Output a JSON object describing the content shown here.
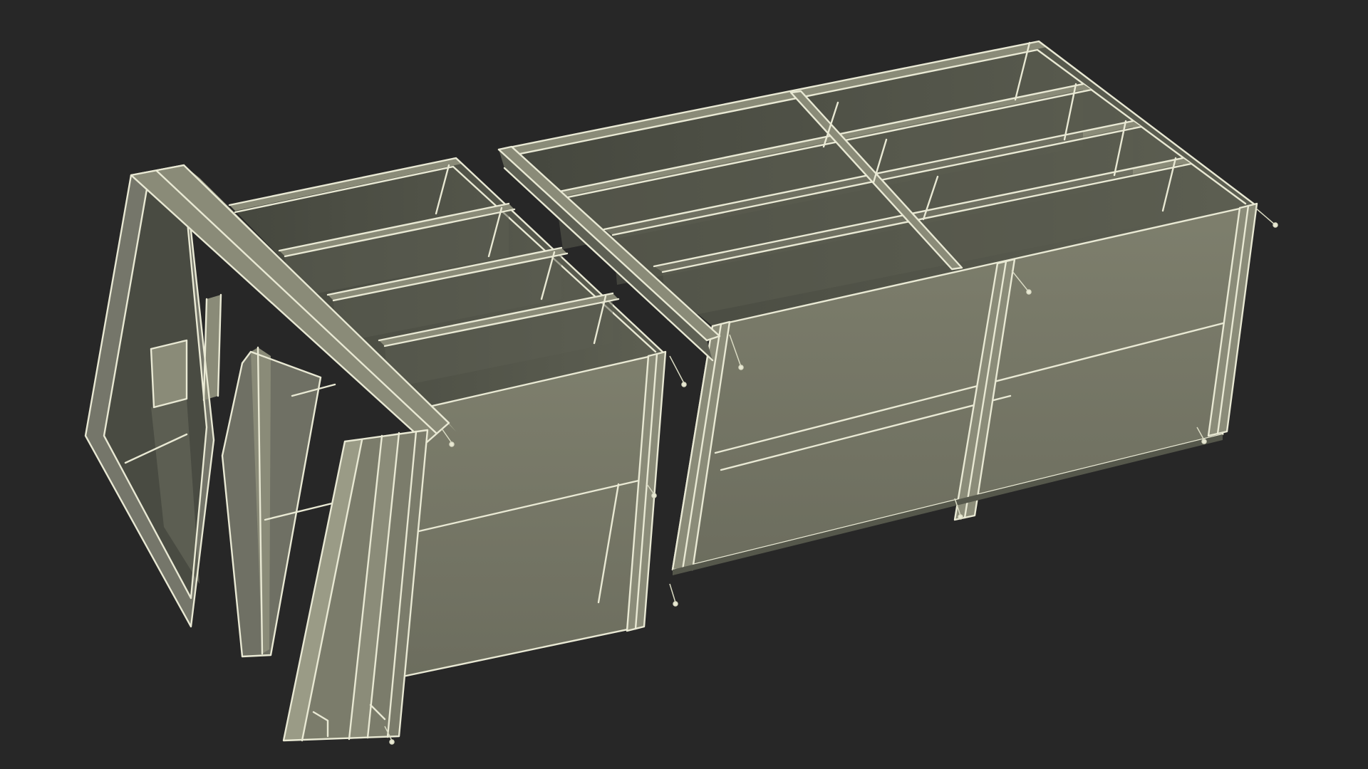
{
  "scene": {
    "subject": "steel-box-frame-wireframe-render",
    "colors": {
      "background": "#272727",
      "panel_light": "#7b7c6a",
      "panel_mid": "#66675a",
      "panel_dark": "#4d4f44",
      "panel_shadow": "#3e4038",
      "wireframe": "#e9e9d4"
    },
    "bays_long_section": 4,
    "bays_short_section": 4
  }
}
